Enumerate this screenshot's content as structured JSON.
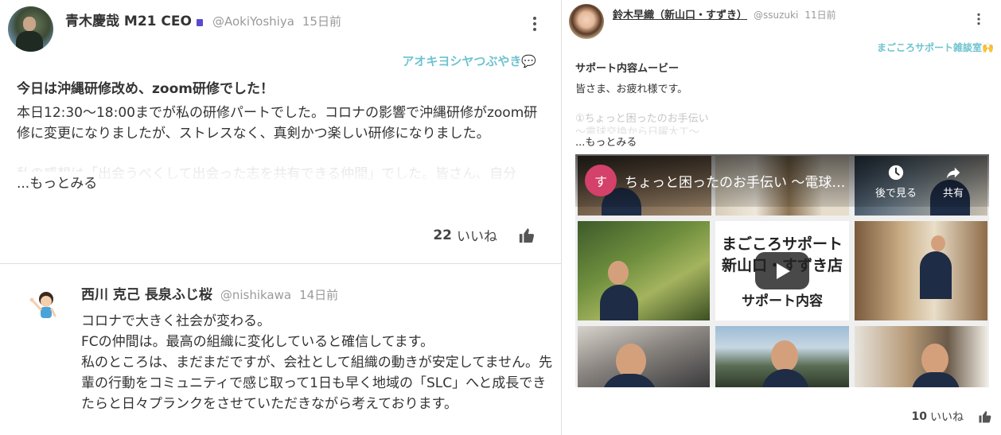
{
  "post1": {
    "author": "青木慶哉 M21 CEO",
    "handle": "@AokiYoshiya",
    "time": "15日前",
    "community": "アオキヨシヤつぶやき💬",
    "title": "今日は沖縄研修改め、zoom研修でした！",
    "body": "本日12:30〜18:00までが私の研修パートでした。コロナの影響で沖縄研修がzoom研修に変更になりましたが、ストレスなく、真剣かつ楽しい研修になりました。",
    "faded_body": "私の感想は「出会うべくして出会った志を共有できる仲間」でした。皆さん、自分",
    "more": "...もっとみる",
    "like_count": "22",
    "like_label": "いいね",
    "icons": {
      "menu": "kebab-icon",
      "like": "thumbs-up-icon",
      "badge": "badge-icon"
    }
  },
  "post2": {
    "author": "西川 克己 長泉ふじ桜",
    "handle": "@nishikawa",
    "time": "14日前",
    "body_lines": [
      "コロナで大きく社会が変わる。",
      "FCの仲間は。最高の組織に変化していると確信してます。",
      "私のところは、まだまだですが、会社として組織の動きが安定してません。先輩の行動をコミュニティで感じ取って1日も早く地域の「SLC」へと成長できたらと日々プランクをさせていただきながら考えております。"
    ]
  },
  "post3": {
    "author": "鈴木早織（新山口・すずき）",
    "handle": "@ssuzuki",
    "time": "11日前",
    "community": "まごころサポート雑談室🙌",
    "title": "サポート内容ムービー",
    "body": "皆さま、お疲れ様です。",
    "faded_line1": "①ちょっと困ったのお手伝い",
    "faded_line2": "〜電球交換から日曜大工〜",
    "more": "...もっとみる",
    "like_count": "10",
    "like_label": "いいね",
    "video": {
      "channel_initial": "す",
      "title": "ちょっと困ったのお手伝い 〜電球交換から日曜大工〜",
      "watch_later": "後で見る",
      "share": "共有",
      "tile_title": "まごころサポート\n新山口・すずき店",
      "tile_subtitle": "サポート内容",
      "icons": {
        "watch_later": "clock-icon",
        "share": "share-arrow-icon",
        "play": "play-icon"
      }
    }
  },
  "colors": {
    "accent": "#6ec3cf",
    "text": "#333333",
    "muted": "#9a9a9a",
    "divider": "#dedede",
    "channel": "#d4416a"
  }
}
